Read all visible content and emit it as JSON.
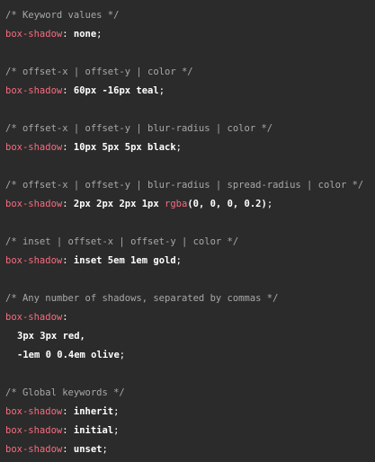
{
  "colors": {
    "background": "#2b2b2b",
    "comment": "#a8a8a8",
    "property": "#f76c7f",
    "value": "#ffffff"
  },
  "lines": {
    "c1": "/* Keyword values */",
    "p1": "box-shadow",
    "v1": "none",
    "c2": "/* offset-x | offset-y | color */",
    "p2": "box-shadow",
    "v2": "60px -16px teal",
    "c3": "/* offset-x | offset-y | blur-radius | color */",
    "p3": "box-shadow",
    "v3": "10px 5px 5px black",
    "c4": "/* offset-x | offset-y | blur-radius | spread-radius | color */",
    "p4": "box-shadow",
    "v4a": "2px 2px 2px 1px ",
    "v4fn": "rgba",
    "v4b": "(0, 0, 0, 0.2)",
    "c5": "/* inset | offset-x | offset-y | color */",
    "p5": "box-shadow",
    "v5": "inset 5em 1em gold",
    "c6": "/* Any number of shadows, separated by commas */",
    "p6": "box-shadow",
    "v6a": "3px 3px red,",
    "v6b": "-1em 0 0.4em olive",
    "c7": "/* Global keywords */",
    "p7": "box-shadow",
    "v7": "inherit",
    "p8": "box-shadow",
    "v8": "initial",
    "p9": "box-shadow",
    "v9": "unset"
  }
}
